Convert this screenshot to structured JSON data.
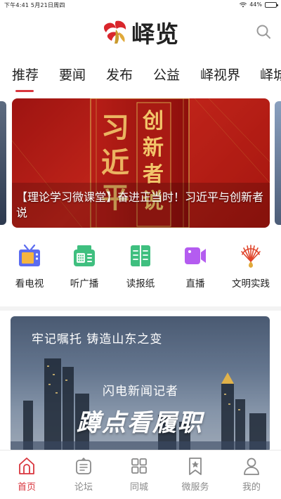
{
  "status_bar": {
    "time_date": "下午4:41   5月21日周四",
    "battery_percent": "44%",
    "battery_level": 0.44
  },
  "header": {
    "app_name": "峄览",
    "search_icon": "search-icon",
    "logo_icon": "brand-logo-icon"
  },
  "tabs": [
    {
      "label": "推荐",
      "active": true
    },
    {
      "label": "要闻"
    },
    {
      "label": "发布"
    },
    {
      "label": "公益"
    },
    {
      "label": "峄视界"
    },
    {
      "label": "峄城"
    }
  ],
  "hero": {
    "caption": "【理论学习微课堂】奋进正当时！习近平与创新者说",
    "bg_text_vertical": "习近平",
    "bg_text_book": "创新者说"
  },
  "quick_menu": [
    {
      "label": "看电视",
      "icon": "tv-icon",
      "color": "#5b6cf0"
    },
    {
      "label": "听广播",
      "icon": "radio-icon",
      "color": "#3fbf7f"
    },
    {
      "label": "读报纸",
      "icon": "newspaper-icon",
      "color": "#3fbf7f"
    },
    {
      "label": "直播",
      "icon": "video-camera-icon",
      "color": "#b45cf0"
    },
    {
      "label": "文明实践",
      "icon": "civilization-emblem-icon",
      "color": "#e0452b"
    }
  ],
  "feature_card": {
    "title": "牢记嘱托 铸造山东之变",
    "overline": "闪电新闻记者",
    "headline": "蹲点看履职"
  },
  "bottom_nav": [
    {
      "label": "首页",
      "icon": "home-icon",
      "active": true
    },
    {
      "label": "论坛",
      "icon": "forum-icon"
    },
    {
      "label": "同城",
      "icon": "grid-icon"
    },
    {
      "label": "微服务",
      "icon": "bookmark-star-icon"
    },
    {
      "label": "我的",
      "icon": "user-icon"
    }
  ],
  "colors": {
    "accent": "#d9363e",
    "inactive": "#8a8a8a"
  }
}
